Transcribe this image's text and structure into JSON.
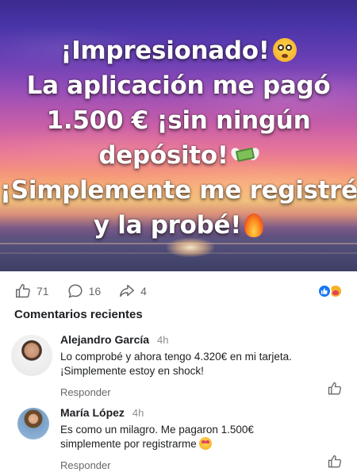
{
  "headline": {
    "line1": "¡Impresionado!",
    "line1_emoji": "flushed-face-emoji",
    "line2": "La aplicación me pagó",
    "line3": "1.500 € ¡sin ningún",
    "line4": "depósito!",
    "line4_emoji": "money-with-wings-emoji",
    "line5": "¡Simplemente me registré",
    "line6": "y la probé!",
    "line6_emoji": "fire-emoji"
  },
  "reactions": {
    "likes": "71",
    "comments": "16",
    "shares": "4",
    "reaction_icons": [
      "like-reaction-icon",
      "care-reaction-icon"
    ]
  },
  "comments_section": {
    "title": "Comentarios recientes",
    "items": [
      {
        "name": "Alejandro García",
        "time": "4h",
        "line1": "Lo comprobé y ahora tengo 4.320€ en mi tarjeta.",
        "line2": "¡Simplemente estoy en shock!",
        "reply_label": "Responder"
      },
      {
        "name": "María López",
        "time": "4h",
        "line1": "Es como un milagro. Me pagaron 1.500€",
        "line2": "simplemente por registrarme",
        "emoji": "heart-eyes-emoji",
        "reply_label": "Responder"
      }
    ]
  },
  "colors": {
    "like_blue": "#1877f2",
    "text_primary": "#1c1e21",
    "text_secondary": "#65676b"
  }
}
